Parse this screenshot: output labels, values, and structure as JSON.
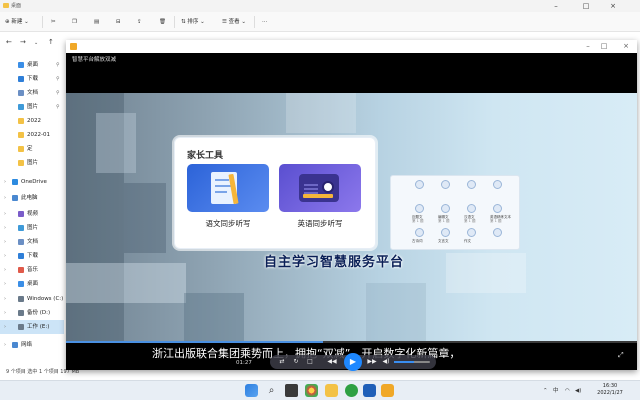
{
  "explorer": {
    "title": "桌面",
    "toolbar": {
      "new": "⊕ 新建 ⌄",
      "sort": "⇅ 排序 ⌄",
      "view": "☰ 查看 ⌄",
      "more": "···"
    },
    "sidebar": [
      {
        "label": "桌面",
        "color": "#3a8ee6",
        "pinned": true
      },
      {
        "label": "下载",
        "color": "#2f7fd8",
        "pinned": true
      },
      {
        "label": "文档",
        "color": "#6b8fc4",
        "pinned": true
      },
      {
        "label": "图片",
        "color": "#3e9ad8",
        "pinned": true
      },
      {
        "label": "2022",
        "color": "#f3c246",
        "pinned": false
      },
      {
        "label": "2022-01",
        "color": "#f3c246",
        "pinned": false
      },
      {
        "label": "定",
        "color": "#f3c246",
        "pinned": false
      },
      {
        "label": "图片",
        "color": "#f3c246",
        "pinned": false
      },
      {
        "label": "OneDrive",
        "color": "#2d8be0",
        "pinned": false
      },
      {
        "label": "此电脑",
        "color": "#4a88d0",
        "pinned": false
      },
      {
        "label": "视频",
        "color": "#7a5cc9",
        "pinned": false
      },
      {
        "label": "图片",
        "color": "#3e9ad8",
        "pinned": false
      },
      {
        "label": "文档",
        "color": "#6b8fc4",
        "pinned": false
      },
      {
        "label": "下载",
        "color": "#2f7fd8",
        "pinned": false
      },
      {
        "label": "音乐",
        "color": "#e05a4a",
        "pinned": false
      },
      {
        "label": "桌面",
        "color": "#3a8ee6",
        "pinned": false
      },
      {
        "label": "Windows (C:)",
        "color": "#6a7a8a",
        "pinned": false
      },
      {
        "label": "备份 (D:)",
        "color": "#6a7a8a",
        "pinned": false
      },
      {
        "label": "工作 (E:)",
        "color": "#6a7a8a",
        "pinned": false
      },
      {
        "label": "网络",
        "color": "#4a88d0",
        "pinned": false
      }
    ],
    "status": "9 个项目    选中 1 个项目  197 MB"
  },
  "player": {
    "window_title": "智慧平台解放双减",
    "card": {
      "title": "家长工具",
      "tiles": [
        "语文同步听写",
        "英语同步听写"
      ]
    },
    "grid_labels": [
      "",
      "",
      "",
      "",
      "迈题文",
      "编辑文",
      "汉语文",
      "英语精练文本",
      "古诗词",
      "文言文",
      "作文",
      ""
    ],
    "grid_sub": [
      "",
      "",
      "",
      "",
      "第 1 题",
      "第 1 题",
      "第 1 题",
      "第 1 题",
      "",
      "",
      "",
      ""
    ],
    "slogan": "自主学习智慧服务平台",
    "subtitle": "浙江出版联合集团乘势而上，拥抱“双减”，开启数字化新篇章，",
    "time": "01:27",
    "progress": 0.45,
    "volume": 0.55
  },
  "taskbar": {
    "clock_time": "16:30",
    "clock_date": "2022/1/27",
    "tray_lang": "中",
    "tray_up": "⌃"
  }
}
